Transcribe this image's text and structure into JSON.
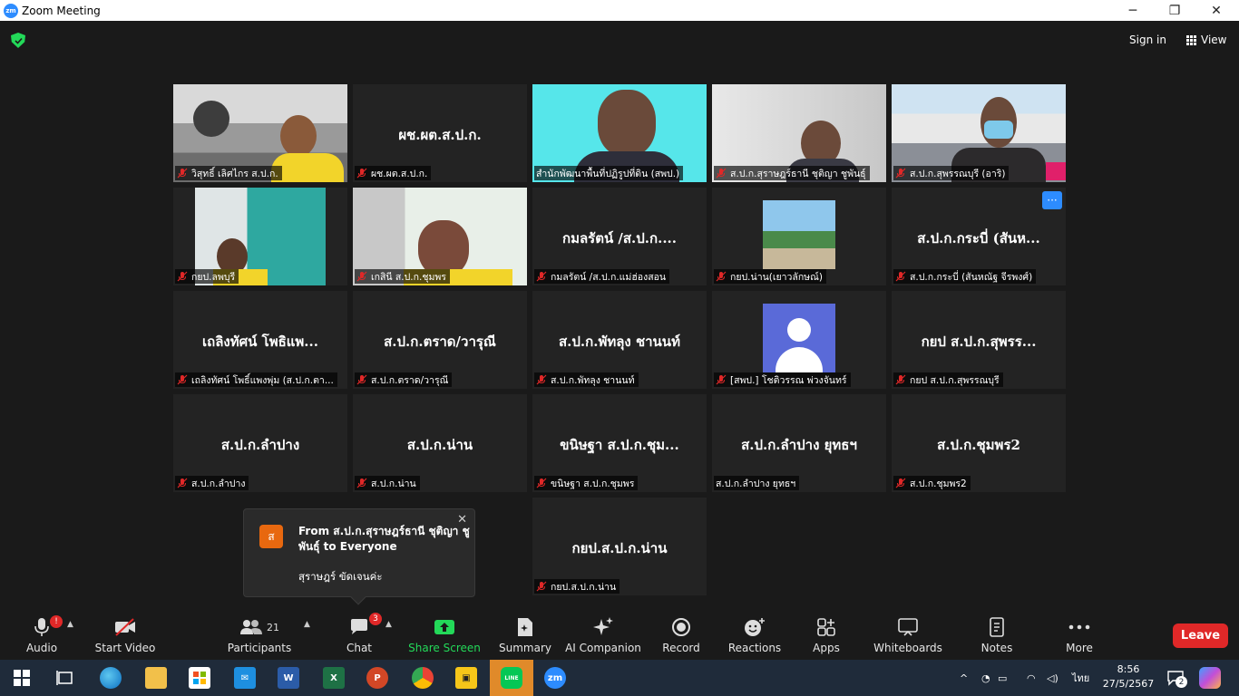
{
  "window": {
    "title": "Zoom Meeting",
    "minimize": "─",
    "maximize": "❐",
    "close": "✕"
  },
  "topbar": {
    "signin_label": "Sign in",
    "view_label": "View"
  },
  "tiles": [
    {
      "big": "",
      "tag": "วิสุทธิ์ เลิศไกร ส.ป.ก.",
      "muted": true,
      "video": "photo-bw"
    },
    {
      "big": "ผช.ผต.ส.ป.ก.",
      "tag": "ผช.ผต.ส.ป.ก.",
      "muted": true,
      "video": ""
    },
    {
      "big": "",
      "tag": "สำนักพัฒนาพื้นที่ปฏิรูปที่ดิน (สพป.)",
      "muted": false,
      "video": "cyan",
      "active": true
    },
    {
      "big": "",
      "tag": "ส.ป.ก.สุราษฎร์ธานี ชุติญา ชูพันธุ์",
      "muted": true,
      "video": "office"
    },
    {
      "big": "",
      "tag": "ส.ป.ก.สุพรรณบุรี (อาริ)",
      "muted": true,
      "video": "outdoor"
    },
    {
      "big": "",
      "tag": "กยป.ลพบุรี",
      "muted": true,
      "video": "room-teal"
    },
    {
      "big": "",
      "tag": "เกสินี ส.ป.ก.ชุมพร",
      "muted": true,
      "video": "room-window"
    },
    {
      "big": "กมลรัตน์ /ส.ป.ก....",
      "tag": "กมลรัตน์ /ส.ป.ก.แม่ฮ่องสอน",
      "muted": true,
      "video": ""
    },
    {
      "big": "",
      "tag": "กยป.น่าน(เยาวลักษณ์)",
      "muted": true,
      "video": "outdoor-small"
    },
    {
      "big": "ส.ป.ก.กระบี่ (สันห...",
      "tag": "ส.ป.ก.กระบี่ (สันหณัฐ จีรพงศ์)",
      "muted": true,
      "video": "",
      "more": true
    },
    {
      "big": "เถลิงทัศน์ โพธิแพ...",
      "tag": "เถลิงทัศน์ โพธิ์แพงพุ่ม (ส.ป.ก.ตา...",
      "muted": true,
      "video": ""
    },
    {
      "big": "ส.ป.ก.ตราด/วารุณี",
      "tag": "ส.ป.ก.ตราด/วารุณี",
      "muted": true,
      "video": ""
    },
    {
      "big": "ส.ป.ก.พัทลุง ชานนท์",
      "tag": "ส.ป.ก.พัทลุง ชานนท์",
      "muted": true,
      "video": ""
    },
    {
      "big": "",
      "tag": "[สพป.] โชติวรรณ พ่วงจันทร์",
      "muted": true,
      "video": "avatar"
    },
    {
      "big": "กยป ส.ป.ก.สุพรร...",
      "tag": "กยป ส.ป.ก.สุพรรณบุรี",
      "muted": true,
      "video": ""
    },
    {
      "big": "ส.ป.ก.ลำปาง",
      "tag": "ส.ป.ก.ลำปาง",
      "muted": true,
      "video": ""
    },
    {
      "big": "ส.ป.ก.น่าน",
      "tag": "ส.ป.ก.น่าน",
      "muted": true,
      "video": ""
    },
    {
      "big": "ขนิษฐา ส.ป.ก.ชุม...",
      "tag": "ขนิษฐา ส.ป.ก.ชุมพร",
      "muted": true,
      "video": ""
    },
    {
      "big": "ส.ป.ก.ลำปาง ยุทธฯ",
      "tag": "ส.ป.ก.ลำปาง ยุทธฯ",
      "muted": false,
      "video": ""
    },
    {
      "big": "ส.ป.ก.ชุมพร2",
      "tag": "ส.ป.ก.ชุมพร2",
      "muted": true,
      "video": ""
    },
    {
      "big": "กยป.ส.ป.ก.น่าน",
      "tag": "กยป.ส.ป.ก.น่าน",
      "muted": true,
      "video": ""
    }
  ],
  "chat_popup": {
    "avatar_letter": "ส",
    "from": "From ส.ป.ก.สุราษฎร์ธานี ชุติญา ชูพันธุ์ to Everyone",
    "message": "สุราษฎร์ ขัดเจนค่ะ",
    "close": "✕"
  },
  "toolbar": {
    "audio": "Audio",
    "audio_badge": "!",
    "video": "Start Video",
    "participants": "Participants",
    "participants_count": "21",
    "chat": "Chat",
    "chat_badge": "3",
    "share": "Share Screen",
    "summary": "Summary",
    "ai": "AI Companion",
    "record": "Record",
    "reactions": "Reactions",
    "apps": "Apps",
    "whiteboards": "Whiteboards",
    "notes": "Notes",
    "more": "More",
    "leave": "Leave"
  },
  "taskbar": {
    "lang": "ไทย",
    "time": "8:56",
    "date": "27/5/2567",
    "notif_count": "2",
    "line_label": "LINE",
    "zoom_label": "zm",
    "ppt_label": "P",
    "word_label": "W",
    "excel_label": "X"
  },
  "colors": {
    "accent_blue": "#2d8cff",
    "leave_red": "#e02828",
    "share_green": "#23d959",
    "active_border": "#c8e84a"
  }
}
